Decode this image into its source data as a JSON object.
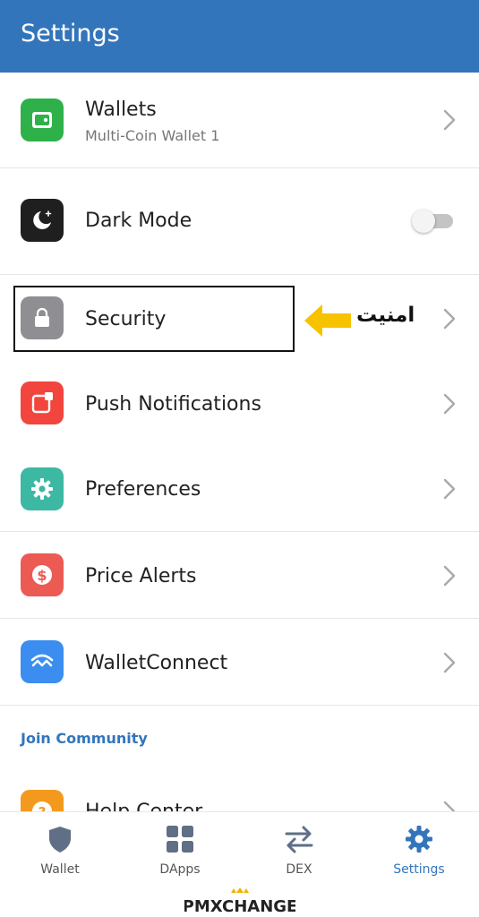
{
  "header": {
    "title": "Settings"
  },
  "rows": {
    "wallets": {
      "label": "Wallets",
      "sublabel": "Multi-Coin Wallet 1"
    },
    "dark_mode": {
      "label": "Dark Mode",
      "toggle_on": false
    },
    "security": {
      "label": "Security"
    },
    "push": {
      "label": "Push Notifications"
    },
    "preferences": {
      "label": "Preferences"
    },
    "price_alerts": {
      "label": "Price Alerts"
    },
    "walletconnect": {
      "label": "WalletConnect"
    },
    "help_center": {
      "label": "Help Center"
    }
  },
  "section": {
    "join_community": "Join Community"
  },
  "annotation": {
    "arrow_text": "امنیت"
  },
  "tabs": [
    {
      "label": "Wallet",
      "icon": "shield-icon"
    },
    {
      "label": "DApps",
      "icon": "grid-icon"
    },
    {
      "label": "DEX",
      "icon": "swap-arrows-icon"
    },
    {
      "label": "Settings",
      "icon": "gear-icon"
    }
  ],
  "watermark": {
    "text": "PMXCHANGE"
  },
  "colors": {
    "brand": "#3375bb",
    "wallets_icon": "#2fb14a",
    "dark_mode_icon": "#1f1f1f",
    "security_icon": "#8e8e93",
    "push_icon": "#f2453d",
    "preferences_icon": "#3cb8a3",
    "price_alerts_icon": "#ec5a54",
    "walletconnect_icon": "#3b8ef0",
    "help_icon": "#f39a1e",
    "arrow": "#f7c200"
  }
}
